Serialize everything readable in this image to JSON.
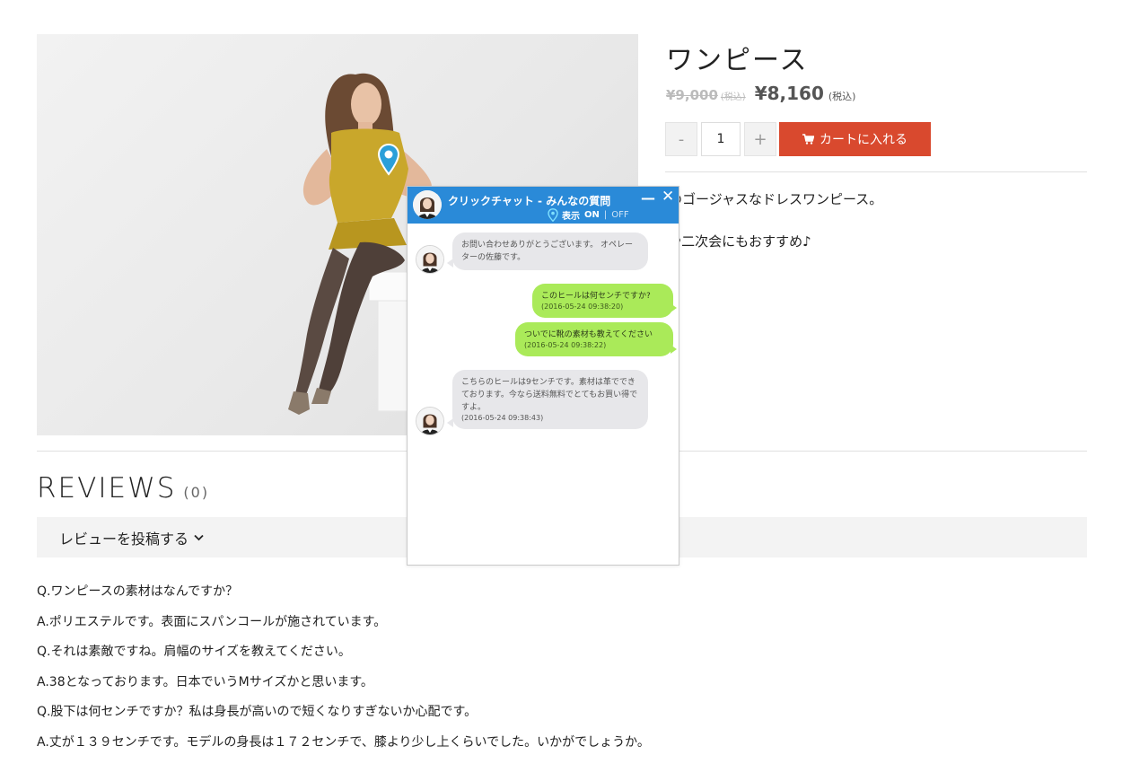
{
  "product": {
    "title": "ワンピース",
    "old_price": "¥9,000",
    "old_tax": "(税込)",
    "new_price": "¥8,160",
    "new_tax": "(税込)",
    "quantity": "1",
    "minus_label": "-",
    "plus_label": "+",
    "cart_label": "カートに入れる",
    "cart_icon": "cart-icon",
    "desc_line1": "メ入りのゴージャスなドレスワンピース。",
    "desc_line2": "ーティや二次会にもおすすめ♪"
  },
  "reviews": {
    "title": "REVIEWS",
    "count": "(0)",
    "post_label": "レビューを投稿する",
    "post_icon": "chevron-down-icon"
  },
  "faq": [
    "Q.ワンピースの素材はなんですか？",
    "A.ポリエステルです。表面にスパンコールが施されています。",
    "Q.それは素敵ですね。肩幅のサイズを教えてください。",
    "A.38となっております。日本でいうMサイズかと思います。",
    "Q.股下は何センチですか？私は身長が高いので短くなりすぎないか心配です。",
    "A.丈が１３９センチです。モデルの身長は１７２センチで、膝より少し上くらいでした。いかがでしょうか。"
  ],
  "chat": {
    "title": "クリックチャット - みんなの質問",
    "minimize": "—",
    "close": "✕",
    "toggle_label": "表示",
    "toggle_on": "ON",
    "toggle_sep": "|",
    "toggle_off": "OFF",
    "accent_color": "#2a8ad8",
    "user_bubble_color": "#aaea59",
    "operator_bubble_color": "#e7e7ea",
    "messages": [
      {
        "from": "operator",
        "text": "お問い合わせありがとうございます。 オペレーターの佐藤です。",
        "time": ""
      },
      {
        "from": "user",
        "text": "このヒールは何センチですか?",
        "time": "(2016-05-24 09:38:20)"
      },
      {
        "from": "user",
        "text": "ついでに靴の素材も教えてください",
        "time": "(2016-05-24 09:38:22)"
      },
      {
        "from": "operator",
        "text": "こちらのヒールは9センチです。素材は革でできております。今なら送料無料でとてもお買い得ですよ。",
        "time": "(2016-05-24 09:38:43)"
      }
    ]
  }
}
